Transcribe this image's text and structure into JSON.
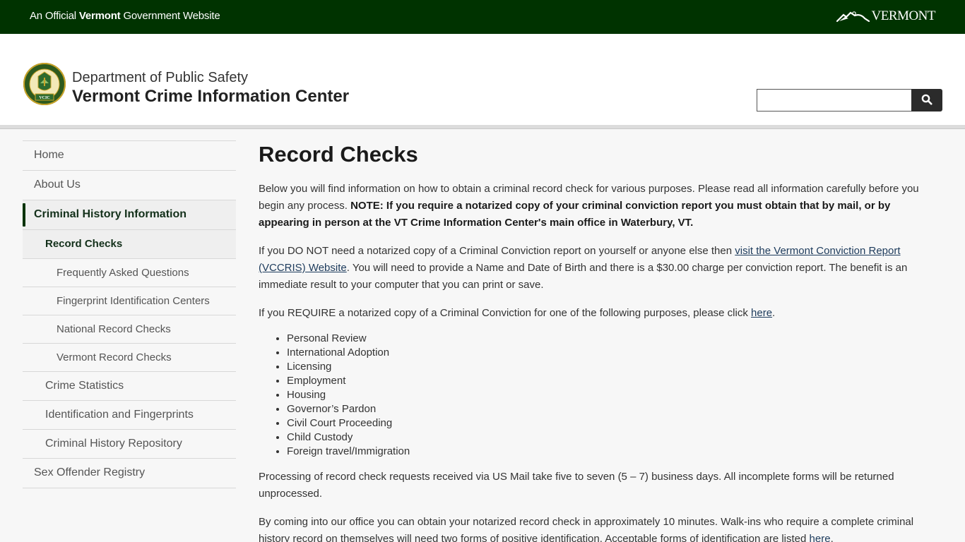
{
  "official_bar": {
    "prefix": "An Official ",
    "bold": "Vermont",
    "suffix": " Government Website",
    "logo_text": "VERMONT",
    "logo_icon": "vermont-mountain-icon"
  },
  "header": {
    "seal_label": "VCIC",
    "seal_icon": "vcic-seal-icon",
    "department": "Department of Public Safety",
    "site_name": "Vermont Crime Information Center",
    "search": {
      "value": "",
      "placeholder": "",
      "button_icon": "search-icon"
    }
  },
  "sidebar": {
    "items": [
      {
        "label": "Home",
        "level": 1
      },
      {
        "label": "About Us",
        "level": 1
      },
      {
        "label": "Criminal History Information",
        "level": 1,
        "state": "active-parent"
      },
      {
        "label": "Record Checks",
        "level": 2,
        "state": "current"
      },
      {
        "label": "Frequently Asked Questions",
        "level": 3
      },
      {
        "label": "Fingerprint Identification Centers",
        "level": 3
      },
      {
        "label": "National Record Checks",
        "level": 3
      },
      {
        "label": "Vermont Record Checks",
        "level": 3
      },
      {
        "label": "Crime Statistics",
        "level": 2
      },
      {
        "label": "Identification and Fingerprints",
        "level": 2
      },
      {
        "label": "Criminal History Repository",
        "level": 2
      },
      {
        "label": "Sex Offender Registry",
        "level": 1
      }
    ]
  },
  "main": {
    "title": "Record Checks",
    "p1_text": "Below you will find information on how to  obtain a criminal record check for various purposes.  Please read all information carefully before you begin any process. ",
    "p1_note": "NOTE: If you require a notarized copy of your criminal conviction report you must obtain that by mail, or by appearing in person at the VT Crime Information Center's main office in Waterbury, VT.",
    "p2_before": "If you DO NOT need a notarized copy of a Criminal Conviction report on yourself or anyone else then ",
    "p2_link": "visit the Vermont Conviction Report (VCCRIS) Website",
    "p2_after": ".  You will need to provide a Name and Date of Birth and there is a $30.00 charge per conviction report.  The benefit is an immediate result to your computer that you can print or save.",
    "p3_before": "If you REQUIRE a notarized copy of a Criminal Conviction for one of the following purposes, please click ",
    "p3_link": "here",
    "p3_after": ".",
    "purposes": [
      "Personal Review",
      "International Adoption",
      "Licensing",
      "Employment",
      "Housing",
      "Governor’s Pardon",
      "Civil Court Proceeding",
      "Child Custody",
      "Foreign travel/Immigration"
    ],
    "p4": "Processing of record check requests received via US Mail take five to seven (5 – 7) business days. All incomplete forms will be returned unprocessed.",
    "p5_before": "By coming into our office you can obtain your notarized record check in approximately 10 minutes.  Walk-ins who require a complete criminal history record on themselves will need two forms of positive identification. Acceptable forms of identification are listed ",
    "p5_link": "here",
    "p5_after": "."
  },
  "colors": {
    "brand_green": "#003300",
    "link": "#1d3b5c",
    "search_button": "#2b2b2b"
  }
}
